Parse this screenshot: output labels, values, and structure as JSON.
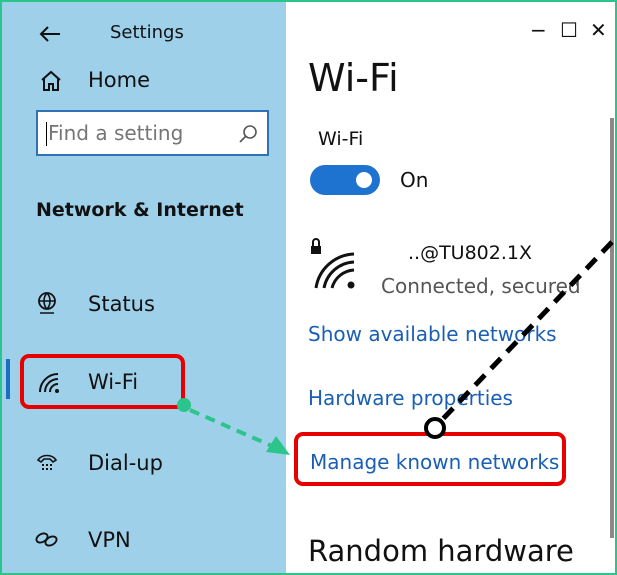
{
  "sidebar": {
    "title": "Settings",
    "home_label": "Home",
    "search_placeholder": "Find a setting",
    "section_title": "Network & Internet",
    "items": [
      {
        "label": "Status",
        "icon": "globe-icon"
      },
      {
        "label": "Wi-Fi",
        "icon": "wifi-icon"
      },
      {
        "label": "Dial-up",
        "icon": "phone-icon"
      },
      {
        "label": "VPN",
        "icon": "vpn-icon"
      }
    ]
  },
  "window": {
    "minimize": "−",
    "maximize": "☐",
    "close": "✕"
  },
  "main": {
    "page_title": "Wi-Fi",
    "wifi_toggle_label": "Wi-Fi",
    "toggle_state": "On",
    "network_name": "..@TU802.1X",
    "network_status": "Connected, secured",
    "links": [
      "Show available networks",
      "Hardware properties",
      "Manage known networks"
    ],
    "section_random": "Random hardware"
  },
  "colors": {
    "sidebar_bg": "#9fd0ea",
    "accent": "#1f73d0",
    "link": "#1a5fb4",
    "highlight": "#e60000",
    "arrow": "#2bc48a"
  }
}
